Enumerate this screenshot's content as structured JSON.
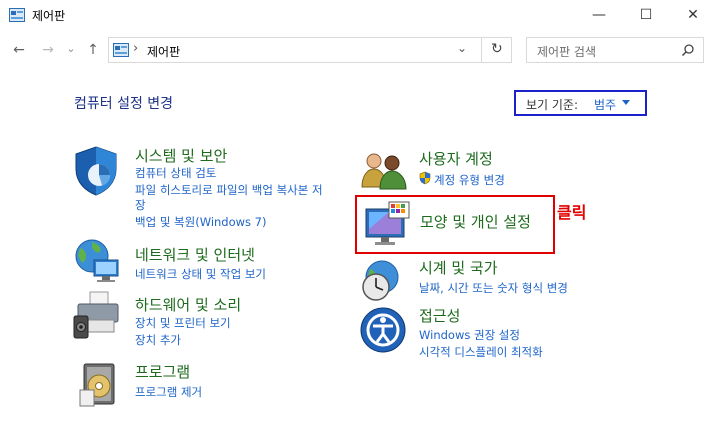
{
  "window": {
    "title": "제어판",
    "minimize_glyph": "—",
    "maximize_glyph": "☐",
    "close_glyph": "✕"
  },
  "nav": {
    "back_glyph": "←",
    "forward_glyph": "→",
    "recent_glyph": "⌄",
    "up_glyph": "↑",
    "breadcrumb_sep": "›",
    "breadcrumb": "제어판",
    "refresh_glyph": "↻",
    "search_placeholder": "제어판 검색"
  },
  "header": {
    "page_title": "컴퓨터 설정 변경",
    "view_by_label": "보기 기준:",
    "view_by_value": "범주"
  },
  "left_categories": [
    {
      "title": "시스템 및 보안",
      "links": [
        "컴퓨터 상태 검토",
        "파일 히스토리로 파일의 백업 복사본 저",
        "장",
        "백업 및 복원(Windows 7)"
      ]
    },
    {
      "title": "네트워크 및 인터넷",
      "links": [
        "네트워크 상태 및 작업 보기"
      ]
    },
    {
      "title": "하드웨어 및 소리",
      "links": [
        "장치 및 프린터 보기",
        "장치 추가"
      ]
    },
    {
      "title": "프로그램",
      "links": [
        "프로그램 제거"
      ]
    }
  ],
  "right_categories": [
    {
      "title": "사용자 계정",
      "links": [
        "계정 유형 변경"
      ]
    },
    {
      "title": "모양 및 개인 설정",
      "links": []
    },
    {
      "title": "시계 및 국가",
      "links": [
        "날짜, 시간 또는 숫자 형식 변경"
      ]
    },
    {
      "title": "접근성",
      "links": [
        "Windows 권장 설정",
        "시각적 디스플레이 최적화"
      ]
    }
  ],
  "annotation": {
    "click_label": "클릭"
  },
  "colors": {
    "category_title": "#1e6b1e",
    "link": "#1e64c8",
    "page_title": "#1e3287",
    "highlight_red": "#e00000",
    "highlight_blue": "#1a22c8"
  },
  "icons": {
    "app": "control-panel-icon",
    "system_security": "shield-icon",
    "network": "globe-network-icon",
    "hardware": "printer-speaker-icon",
    "programs": "programs-disc-icon",
    "user_accounts": "users-icon",
    "uac": "uac-shield-icon",
    "appearance": "monitor-palette-icon",
    "clock_region": "clock-globe-icon",
    "accessibility": "accessibility-icon"
  }
}
